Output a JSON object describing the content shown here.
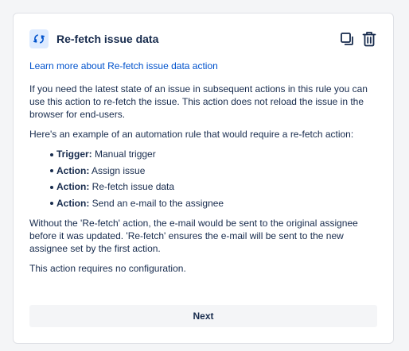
{
  "panel": {
    "title": "Re-fetch issue data",
    "icon": "refresh-icon",
    "tools": [
      "duplicate-icon",
      "trash-icon"
    ]
  },
  "body": {
    "learn_more": "Learn more about Re-fetch issue data action",
    "intro": "If you need the latest state of an issue in subsequent actions in this rule you can use this action to re-fetch the issue. This action does not reload the issue in the browser for end-users.",
    "example_intro": "Here's an example of an automation rule that would require a re-fetch action:",
    "steps": [
      {
        "label": "Trigger:",
        "text": " Manual trigger"
      },
      {
        "label": "Action:",
        "text": " Assign issue"
      },
      {
        "label": "Action:",
        "text": " Re-fetch issue data"
      },
      {
        "label": "Action:",
        "text": " Send an e-mail to the assignee"
      }
    ],
    "explanation": "Without the 'Re-fetch' action, the e-mail would be sent to the original assignee before it was updated. 'Re-fetch' ensures the e-mail will be sent to the new assignee set by the first action.",
    "no_config": "This action requires no configuration."
  },
  "footer": {
    "next_label": "Next"
  },
  "colors": {
    "accent": "#0052cc",
    "text": "#172b4d",
    "icon_bg": "#deebff",
    "button_bg": "#f4f5f7"
  }
}
